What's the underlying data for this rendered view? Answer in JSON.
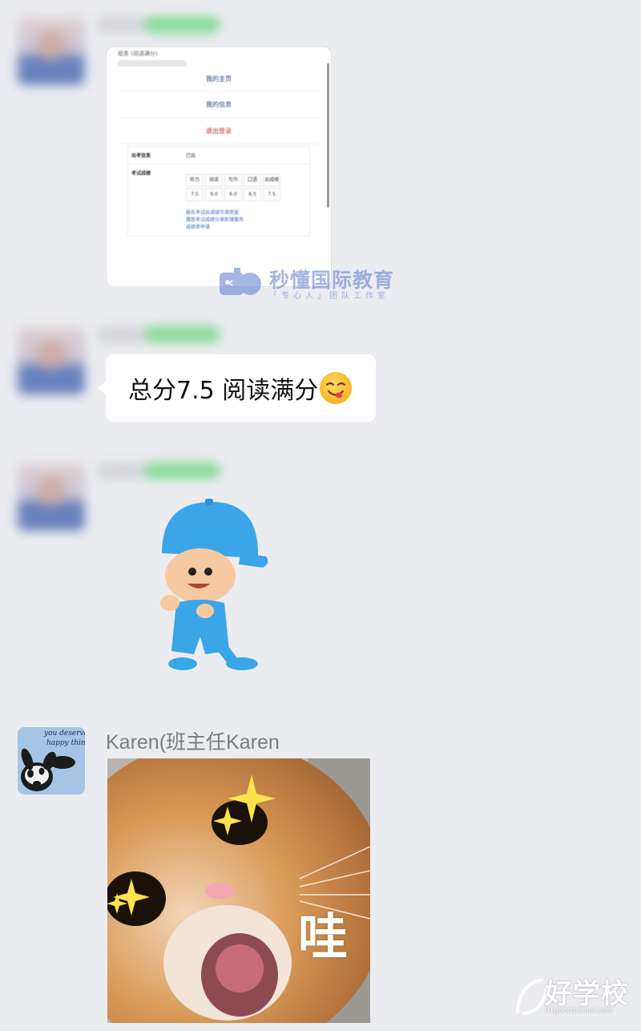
{
  "screenshot_card": {
    "header_text": "纸条 (阅读满分)",
    "rows": [
      "我的主页",
      "我的信息",
      "退出登录"
    ],
    "table": {
      "status_label": "出考信息",
      "status_value": "已出",
      "score_label": "考试成绩",
      "headers": [
        "听力",
        "阅读",
        "写作",
        "口语",
        "总成绩"
      ],
      "scores": [
        "7.5",
        "9.0",
        "6.0",
        "6.5",
        "7.5"
      ],
      "links": [
        "报名考试后请填写满意度",
        "雅思考试成绩分享新增服务",
        "成绩单申请"
      ]
    }
  },
  "watermark": {
    "main": "秒懂国际教育",
    "sub": "「专心人」团队工作室"
  },
  "messages": {
    "text_message": "总分7.5 阅读满分",
    "sender_karen": "Karen(班主任Karen"
  },
  "karen_avatar_text": [
    "you deserve",
    "happy things"
  ],
  "cat_sticker_text": "哇",
  "bottom_logo": {
    "name": "好学校",
    "url": "91goodschool.com"
  }
}
